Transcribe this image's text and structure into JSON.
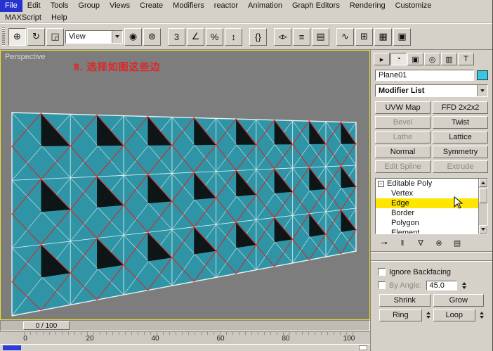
{
  "colors": {
    "menu_highlight": "#2633cf"
  },
  "menubar": {
    "items": [
      "File",
      "Edit",
      "Tools",
      "Group",
      "Views",
      "Create",
      "Modifiers",
      "reactor",
      "Animation",
      "Graph Editors",
      "Rendering",
      "Customize"
    ],
    "active_item": "File",
    "row2": [
      "MAXScript",
      "Help"
    ]
  },
  "toolbar": {
    "view_dropdown_value": "View",
    "icons": [
      {
        "name": "select-and-move",
        "glyph": "⊕"
      },
      {
        "name": "select-and-rotate",
        "glyph": "↻"
      },
      {
        "name": "select-and-uniform-scale",
        "glyph": "◲"
      },
      {
        "name": "use-pivot-point-center",
        "glyph": "◉"
      },
      {
        "name": "select-and-manipulate",
        "glyph": "⊛"
      },
      {
        "name": "snap-toggle-3d",
        "glyph": "3"
      },
      {
        "name": "angle-snap-toggle",
        "glyph": "∠"
      },
      {
        "name": "percent-snap-toggle",
        "glyph": "%"
      },
      {
        "name": "spinner-snap-toggle",
        "glyph": "↕"
      },
      {
        "name": "named-selection-sets",
        "glyph": "{}"
      },
      {
        "name": "mirror",
        "glyph": "◃▹"
      },
      {
        "name": "align",
        "glyph": "≡"
      },
      {
        "name": "layer-manager",
        "glyph": "▤"
      },
      {
        "name": "curve-editor",
        "glyph": "∿"
      },
      {
        "name": "schematic-view",
        "glyph": "⊞"
      },
      {
        "name": "material-editor",
        "glyph": "▦"
      },
      {
        "name": "render-scene",
        "glyph": "▣"
      }
    ]
  },
  "viewport": {
    "label": "Perspective",
    "annotation": "8. 选择如图这些边",
    "annotation_color": "#e02525",
    "colors": {
      "bg": "#7d7d7d",
      "plane": "#2f95a6",
      "wire": "#e6f2f2",
      "hole": "#0b0b0b",
      "selected": "#cf2b2b",
      "border": "#eadf2a"
    }
  },
  "command_panel": {
    "tabs": [
      {
        "name": "create",
        "glyph": "▸"
      },
      {
        "name": "modify",
        "glyph": "◔"
      },
      {
        "name": "hierarchy",
        "glyph": "▣"
      },
      {
        "name": "motion",
        "glyph": "◎"
      },
      {
        "name": "display",
        "glyph": "▥"
      },
      {
        "name": "utilities",
        "glyph": "T"
      }
    ],
    "object_name": "Plane01",
    "object_color": "#35c8e0",
    "modifier_list_label": "Modifier List",
    "modifier_buttons": [
      {
        "label": "UVW Map",
        "enabled": true
      },
      {
        "label": "FFD 2x2x2",
        "enabled": true
      },
      {
        "label": "Bevel",
        "enabled": false
      },
      {
        "label": "Twist",
        "enabled": true
      },
      {
        "label": "Lathe",
        "enabled": false
      },
      {
        "label": "Lattice",
        "enabled": true
      },
      {
        "label": "Normal",
        "enabled": true
      },
      {
        "label": "Symmetry",
        "enabled": true
      },
      {
        "label": "Edit Spline",
        "enabled": false
      },
      {
        "label": "Extrude",
        "enabled": false
      }
    ],
    "stack": {
      "collapse_glyph": "−",
      "root": "Editable Poly",
      "items": [
        "Vertex",
        "Edge",
        "Border",
        "Polygon",
        "Element"
      ],
      "selected": "Edge",
      "selected_color": "#ffe600"
    },
    "stack_tools": [
      {
        "name": "pin-stack",
        "glyph": "⊸"
      },
      {
        "name": "show-end-result",
        "glyph": "‖"
      },
      {
        "name": "make-unique",
        "glyph": "∇"
      },
      {
        "name": "remove-modifier",
        "glyph": "⊗"
      },
      {
        "name": "configure-modifier-sets",
        "glyph": "▤"
      }
    ],
    "selection_rollout": {
      "ignore_backfacing_label": "Ignore Backfacing",
      "by_angle_label": "By Angle:",
      "angle_value": "45.0",
      "shrink_label": "Shrink",
      "grow_label": "Grow",
      "ring_label": "Ring",
      "loop_label": "Loop"
    }
  },
  "timeline": {
    "slider_label": "0 / 100",
    "ticks": [
      "0",
      "20",
      "40",
      "60",
      "80",
      "100"
    ]
  }
}
